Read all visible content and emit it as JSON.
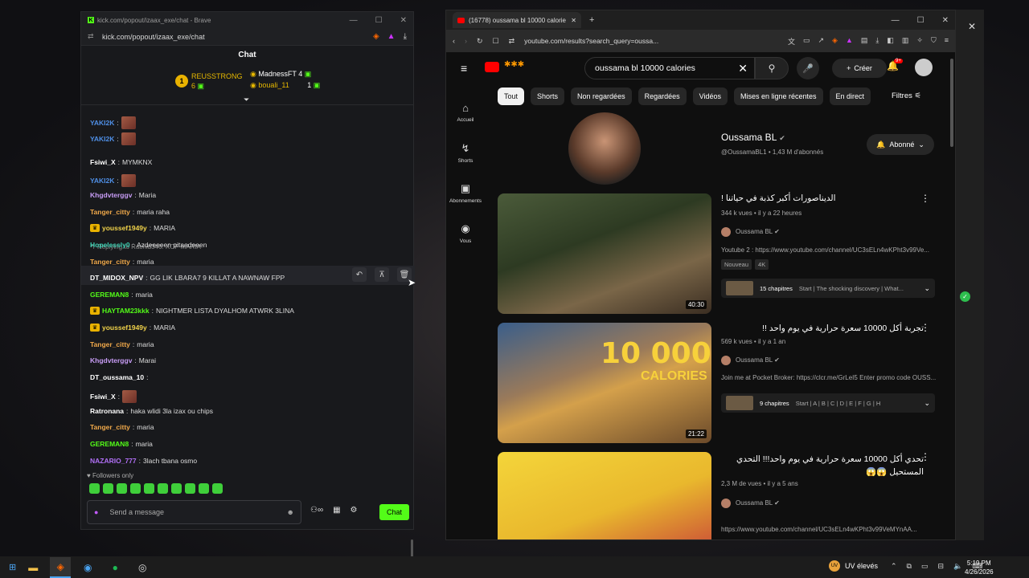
{
  "kick": {
    "window_title": "kick.com/popout/izaax_exe/chat - Brave",
    "url": "kick.com/popout/izaax_exe/chat",
    "chat_header": "Chat",
    "leaderboard": {
      "first_rank": "1",
      "first_name": "REUSSTRONG",
      "first_count": "6",
      "second_name": "MadnessFT",
      "second_count": "4",
      "third_name": "bouali_11",
      "third_count": "1"
    },
    "reply_to": "Replying to Rachid346: XOF MARIA",
    "messages": [
      {
        "user": "YAKI2K",
        "text": "",
        "color": "#4f8fe6",
        "emote": true
      },
      {
        "user": "YAKI2K",
        "text": "",
        "color": "#4f8fe6",
        "emote": true
      },
      {
        "user": "Fsiwi_X",
        "text": "MYMKNX",
        "color": "#ffffff"
      },
      {
        "user": "YAKI2K",
        "text": "",
        "color": "#4f8fe6",
        "emote": true
      },
      {
        "user": "Khgdvterggv",
        "text": "Maria",
        "color": "#c79cf5"
      },
      {
        "user": "Tanger_citty",
        "text": "maria raha",
        "color": "#f1a94a"
      },
      {
        "user": "youssef1949y",
        "text": "MARIA",
        "color": "#f0d24a",
        "crown": true
      },
      {
        "user": "Hopelessly0",
        "text": "Azdeeeeen pitaadeeen",
        "color": "#3ccfb1"
      },
      {
        "user": "Tanger_citty",
        "text": "maria",
        "color": "#f1a94a"
      },
      {
        "user": "DT_MIDOX_NPV",
        "text": "GG LIK LBARA7 9 KILLAT A NAWNAW FPP",
        "color": "#ffffff"
      },
      {
        "user": "GEREMAN8",
        "text": "maria",
        "color": "#53fc18"
      },
      {
        "user": "HAYTAM23kkk",
        "text": "NIGHTMER LISTA DYALHOM ATWRK 3LINA",
        "color": "#53fc18",
        "crown": true
      },
      {
        "user": "youssef1949y",
        "text": "MARIA",
        "color": "#f0d24a",
        "crown": true
      },
      {
        "user": "Tanger_citty",
        "text": "maria",
        "color": "#f1a94a"
      },
      {
        "user": "Khgdvterggv",
        "text": "Marai",
        "color": "#c79cf5"
      },
      {
        "user": "DT_oussama_10",
        "text": "",
        "color": "#ffffff"
      },
      {
        "user": "Fsiwi_X",
        "text": "",
        "color": "#ffffff",
        "emote": true
      },
      {
        "user": "Ratronana",
        "text": "haka wlidi 3la izax ou chips",
        "color": "#ffffff"
      },
      {
        "user": "Tanger_citty",
        "text": "maria",
        "color": "#f1a94a"
      },
      {
        "user": "GEREMAN8",
        "text": "maria",
        "color": "#53fc18"
      },
      {
        "user": "NAZARIO_777",
        "text": "3lach tbana osmo",
        "color": "#b06ff5"
      }
    ],
    "followers_only": "Followers only",
    "input_placeholder": "Send a message",
    "send_label": "Chat"
  },
  "youtube": {
    "tab_title": "(16778) oussama bl 10000 calorie",
    "url": "youtube.com/results?search_query=oussa...",
    "search_value": "oussama bl 10000 calories",
    "create_label": "Créer",
    "notif_count": "9+",
    "sidebar": [
      {
        "label": "Accueil",
        "icon": "⌂"
      },
      {
        "label": "Shorts",
        "icon": "↯"
      },
      {
        "label": "Abonnements",
        "icon": "▣"
      },
      {
        "label": "Vous",
        "icon": "◉"
      }
    ],
    "chips": [
      "Tout",
      "Shorts",
      "Non regardées",
      "Regardées",
      "Vidéos",
      "Mises en ligne récentes",
      "En direct"
    ],
    "filters_label": "Filtres",
    "channel": {
      "name": "Oussama BL",
      "handle_subs": "@OussamaBL1 • 1,43 M d'abonnés",
      "subscribed": "Abonné"
    },
    "videos": [
      {
        "title": "الديناصورات أكبر كذبة في حياتنا !",
        "meta": "344 k vues • il y a 22 heures",
        "channel": "Oussama BL",
        "desc": "Youtube 2 : https://www.youtube.com/channel/UC3sELn4wKPht3v99Ve...",
        "tags": [
          "Nouveau",
          "4K"
        ],
        "chapters": "15 chapitres",
        "chapters_desc": "Start | The shocking discovery | What...",
        "duration": "40:30"
      },
      {
        "title": "تجربة أكل 10000 سعرة حرارية في يوم واحد !!",
        "meta": "569 k vues • il y a 1 an",
        "channel": "Oussama BL",
        "desc": "Join me at Pocket Broker: https://clcr.me/GrLeI5 Enter promo code OUSS...",
        "thumb_big": "10 000",
        "thumb_small": "CALORIES",
        "chapters": "9 chapitres",
        "chapters_desc": "Start | A | B | C | D | E | F | G | H",
        "duration": "21:22"
      },
      {
        "title": "تحدي أكل 10000 سعرة حرارية في يوم واحد!!! التحدي المستحيل 😱😱",
        "meta": "2,3 M de vues • il y a 5 ans",
        "channel": "Oussama BL",
        "desc": "https://www.youtube.com/channel/UC3sELn4wKPht3v99VeMYnAA..."
      }
    ]
  },
  "taskbar": {
    "weather": "UV élevés",
    "time": "5:19 PM",
    "date": "4/26/2026"
  }
}
